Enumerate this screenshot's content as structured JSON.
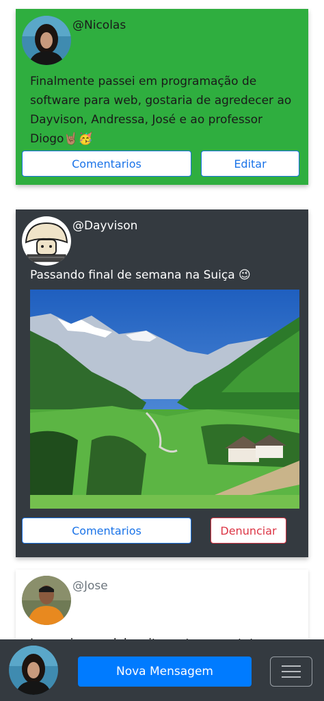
{
  "posts": [
    {
      "username": "@Nicolas",
      "text": "Finalmente passei em programação de software para web, gostaria de agredecer ao Dayvison, Andressa, José e ao professor Diogo🤘🏽🥳",
      "buttons": {
        "comments": "Comentarios",
        "action": "Editar"
      }
    },
    {
      "username": "@Dayvison",
      "text": "Passando final de semana na Suiça 😉",
      "buttons": {
        "comments": "Comentarios",
        "action": "Denunciar"
      }
    },
    {
      "username": "@Jose",
      "text": "Lorem ipsum dolor sit amet, consectetur"
    }
  ],
  "bottom_bar": {
    "new_message_label": "Nova Mensagem"
  },
  "colors": {
    "accent": "#007bff",
    "card_green": "#2fae3f",
    "card_dark": "#343a40",
    "danger": "#dc3545"
  },
  "icons": {
    "menu": "hamburger-menu-icon"
  }
}
